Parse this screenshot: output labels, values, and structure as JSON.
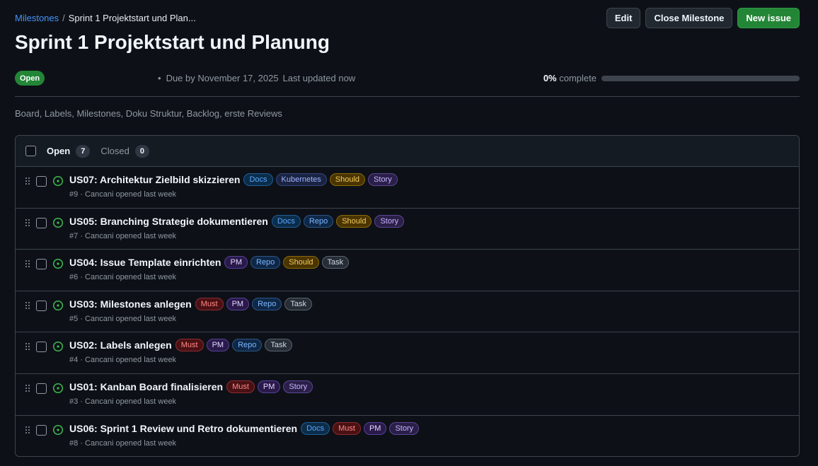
{
  "breadcrumb": {
    "parent": "Milestones",
    "separator": "/",
    "current": "Sprint 1 Projektstart und Plan..."
  },
  "actions": {
    "edit": "Edit",
    "close": "Close Milestone",
    "new_issue": "New issue"
  },
  "milestone": {
    "title": "Sprint 1 Projektstart und Planung",
    "state": "Open",
    "separator_dot": "•",
    "due": "Due by November 17, 2025",
    "updated": "Last updated now",
    "progress_pct": "0%",
    "progress_label": "complete",
    "progress_fraction": 0,
    "description": "Board, Labels, Milestones, Doku Struktur, Backlog, erste Reviews"
  },
  "tabs": {
    "open_label": "Open",
    "open_count": "7",
    "closed_label": "Closed",
    "closed_count": "0"
  },
  "colors": {
    "accent_green": "#238636",
    "link_blue": "#4493f8",
    "open_icon": "#3fb950"
  },
  "issues": [
    {
      "title": "US07: Architektur Zielbild skizzieren",
      "labels": [
        "Docs",
        "Kubernetes",
        "Should",
        "Story"
      ],
      "number": "#9",
      "meta": "· Cancani opened last week"
    },
    {
      "title": "US05: Branching Strategie dokumentieren",
      "labels": [
        "Docs",
        "Repo",
        "Should",
        "Story"
      ],
      "number": "#7",
      "meta": "· Cancani opened last week"
    },
    {
      "title": "US04: Issue Template einrichten",
      "labels": [
        "PM",
        "Repo",
        "Should",
        "Task"
      ],
      "number": "#6",
      "meta": "· Cancani opened last week"
    },
    {
      "title": "US03: Milestones anlegen",
      "labels": [
        "Must",
        "PM",
        "Repo",
        "Task"
      ],
      "number": "#5",
      "meta": "· Cancani opened last week"
    },
    {
      "title": "US02: Labels anlegen",
      "labels": [
        "Must",
        "PM",
        "Repo",
        "Task"
      ],
      "number": "#4",
      "meta": "· Cancani opened last week"
    },
    {
      "title": "US01: Kanban Board finalisieren",
      "labels": [
        "Must",
        "PM",
        "Story"
      ],
      "number": "#3",
      "meta": "· Cancani opened last week"
    },
    {
      "title": "US06: Sprint 1 Review und Retro dokumentieren",
      "labels": [
        "Docs",
        "Must",
        "PM",
        "Story"
      ],
      "number": "#8",
      "meta": "· Cancani opened last week"
    }
  ]
}
